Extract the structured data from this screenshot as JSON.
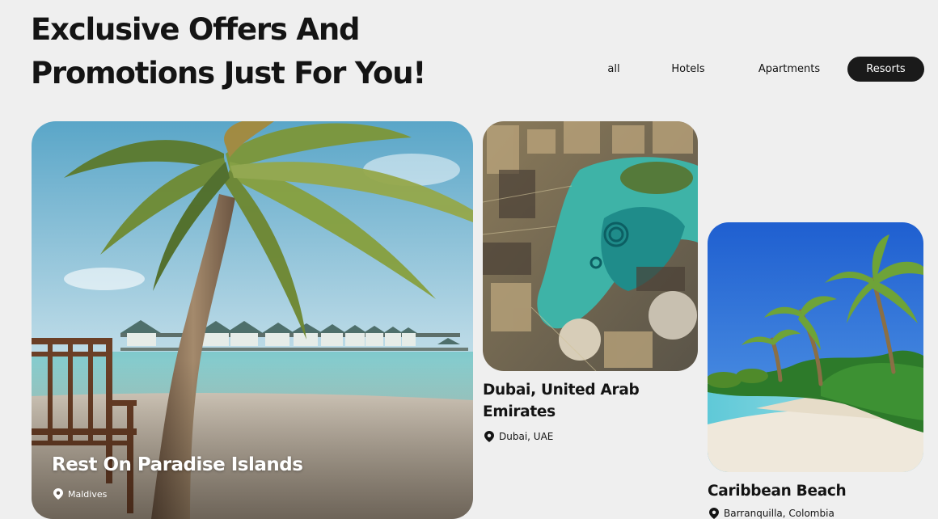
{
  "headline": {
    "line1": "Exclusive Offers And",
    "line2": "Promotions Just For You!"
  },
  "filters": {
    "all": "all",
    "hotels": "Hotels",
    "apartments": "Apartments",
    "resorts": "Resorts",
    "active": "Resorts"
  },
  "cards": {
    "paradise": {
      "title": "Rest On Paradise Islands",
      "location": "Maldives"
    },
    "dubai": {
      "title_line1": "Dubai, United Arab",
      "title_line2": "Emirates",
      "location": "Dubai, UAE"
    },
    "caribbean": {
      "title": "Caribbean Beach",
      "location": "Barranquilla, Colombia"
    }
  },
  "icons": {
    "location": "map-pin-icon"
  },
  "colors": {
    "background": "#efefef",
    "active_pill": "#1a1a1a",
    "text": "#141414"
  }
}
